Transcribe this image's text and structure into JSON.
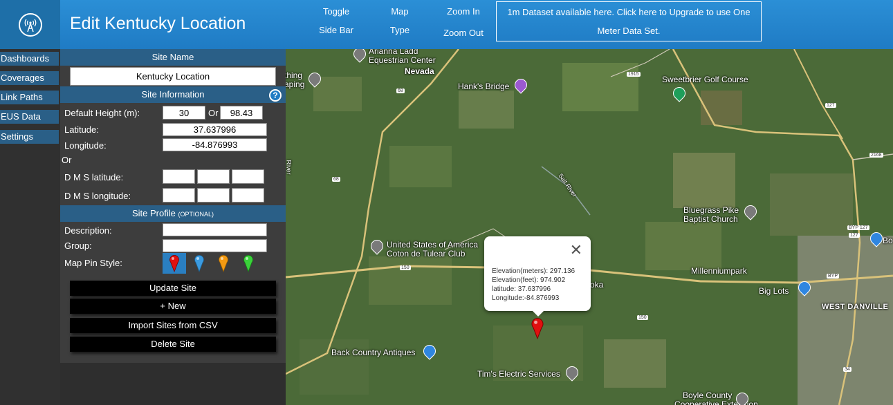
{
  "header": {
    "title": "Edit Kentucky Location",
    "toggle_line1": "Toggle",
    "toggle_line2": "Side Bar",
    "maptype_line1": "Map",
    "maptype_line2": "Type",
    "zoom_in": "Zoom In",
    "zoom_out": "Zoom Out",
    "upgrade_line1": "1m Dataset available here. Click here to Upgrade to use One",
    "upgrade_line2": "Meter Data Set."
  },
  "nav": {
    "items": [
      "Dashboards",
      "Coverages",
      "Link Paths",
      "EUS Data",
      "Settings"
    ]
  },
  "panel": {
    "site_name_head": "Site Name",
    "site_name_value": "Kentucky Location",
    "site_info_head": "Site Information",
    "default_height_label": "Default Height (m):",
    "height_m": "30",
    "or_label": "Or",
    "height_ft": "98.43",
    "latitude_label": "Latitude:",
    "latitude_value": "37.637996",
    "longitude_label": "Longitude:",
    "longitude_value": "-84.876993",
    "or_label2": "Or",
    "dms_lat_label": "D M S latitude:",
    "dms_lon_label": "D M S longitude:",
    "profile_head": "Site Profile",
    "profile_optional": "(OPTIONAL)",
    "description_label": "Description:",
    "description_value": "",
    "group_label": "Group:",
    "group_value": "",
    "pin_style_label": "Map Pin Style:",
    "pin_colors": [
      "#e01010",
      "#3b9be0",
      "#f39a12",
      "#3ad23a"
    ],
    "update_btn": "Update Site",
    "new_btn": "+ New",
    "import_btn": "Import Sites from CSV",
    "delete_btn": "Delete Site"
  },
  "map": {
    "labels": {
      "arianna1": "Arianna Ladd",
      "arianna2": "Equestrian Center",
      "nevada": "Nevada",
      "thing1": "thing",
      "thing2": "aping",
      "hanks": "Hank's Bridge",
      "sweetbrier": "Sweetbrier Golf Course",
      "bluegrass1": "Bluegrass Pike",
      "bluegrass2": "Baptist Church",
      "usa1": "United States of America",
      "usa2": "Coton de Tulear Club",
      "millennium": "Millenniumpark",
      "biglots": "Big Lots",
      "westdanville": "WEST DANVILLE",
      "bo": "Bo",
      "back_country": "Back Country Antiques",
      "tims": "Tim's Electric Services",
      "boyle1": "Boyle County",
      "boyle2": "Cooperative Extension",
      "salt_river": "Salt River",
      "river": "River",
      "oka": "oka"
    },
    "shields": [
      "68",
      "68",
      "1915",
      "127",
      "2168",
      "127",
      "150",
      "150",
      "BYP 127",
      "BYP",
      "34"
    ],
    "popup": {
      "elev_m": "Elevation(meters): 297.136",
      "elev_ft": "Elevation(feet): 974.902",
      "lat": "latitude: 37.637996",
      "lon": "Longitude:-84.876993"
    }
  }
}
